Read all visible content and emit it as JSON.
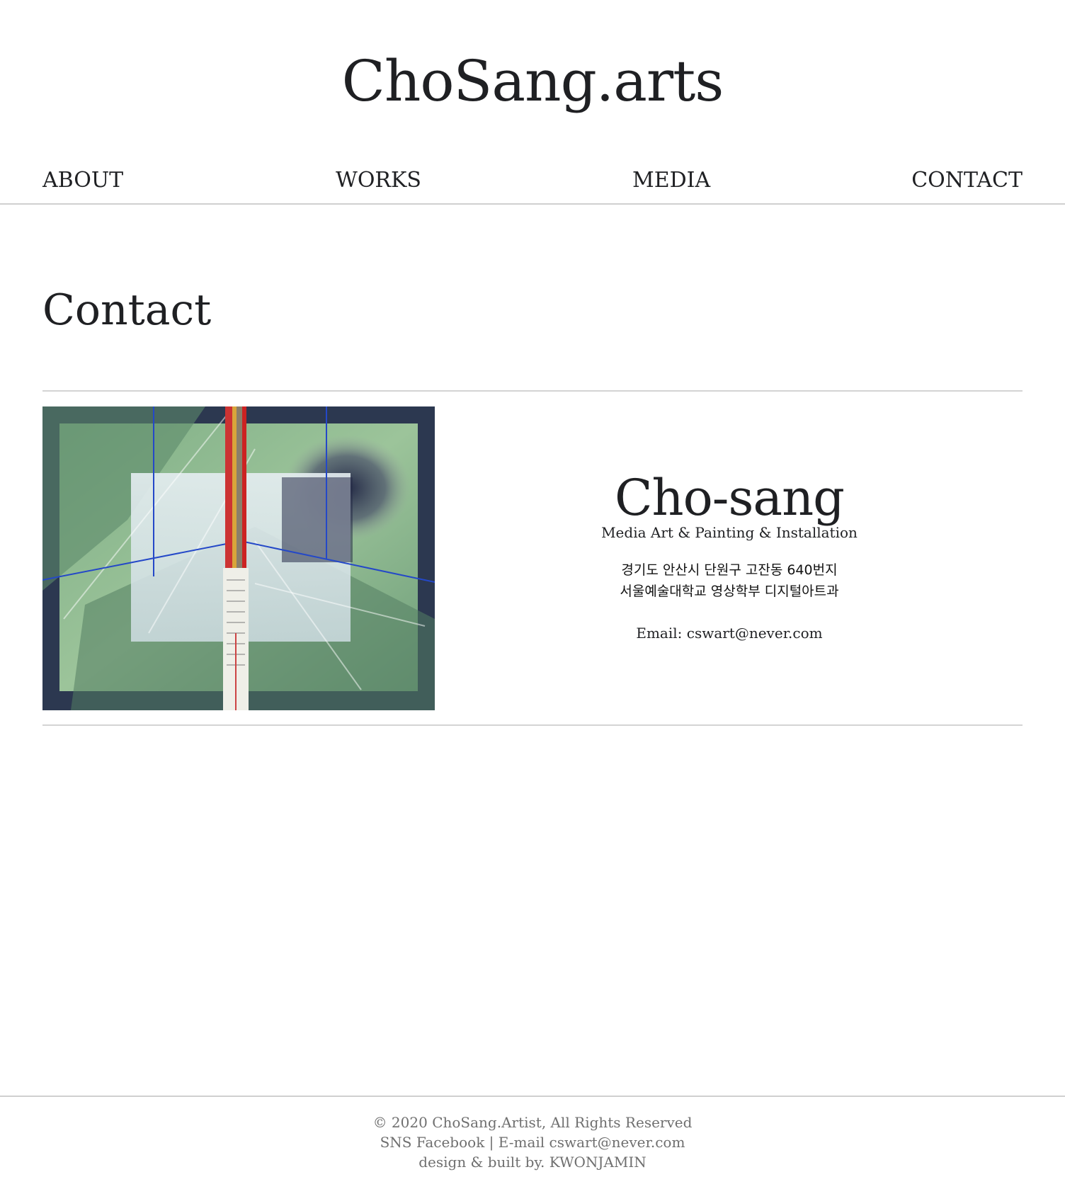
{
  "site": {
    "title": "ChoSang.arts"
  },
  "nav": {
    "items": [
      {
        "label": "ABOUT"
      },
      {
        "label": "WORKS"
      },
      {
        "label": "MEDIA"
      },
      {
        "label": "CONTACT"
      }
    ]
  },
  "page": {
    "heading": "Contact"
  },
  "contact_card": {
    "name": "Cho-sang",
    "subtitle": "Media Art & Painting & Installation",
    "address_line1": "경기도 안산시 단원구 고잔동 640번지",
    "address_line2": "서울예술대학교 영상학부 디지털아트과",
    "email": "Email: cswart@never.com"
  },
  "footer": {
    "line1": "© 2020 ChoSang.Artist, All Rights Reserved",
    "line2": "SNS Facebook | E-mail cswart@never.com",
    "line3": "design & built by. KWONJAMIN"
  },
  "colors": {
    "text": "#1f2023",
    "rule": "#d4d4d4",
    "footer_text": "#6f6f6f",
    "artwork_green": "#8fbf8f",
    "artwork_frame": "#2e3a4d"
  }
}
